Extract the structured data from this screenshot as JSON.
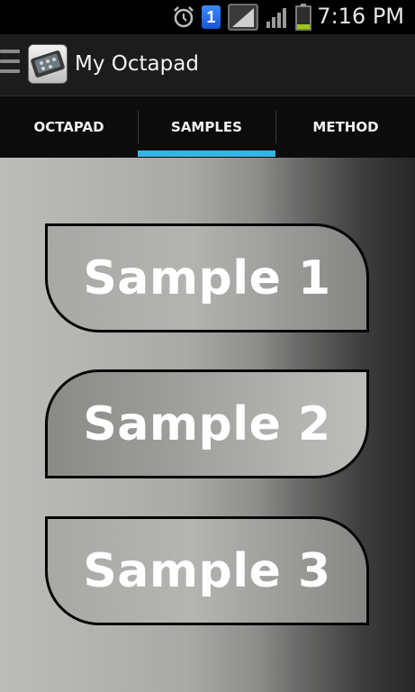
{
  "status_bar": {
    "time": "7:16 PM",
    "notification_badge": "1",
    "icons": [
      "alarm-icon",
      "notification-badge-icon",
      "wifi-signal-icon",
      "cell-signal-icon",
      "battery-icon"
    ]
  },
  "action_bar": {
    "title": "My Octapad",
    "icon": "app-octapad-icon",
    "menu_icon": "drawer-menu-icon"
  },
  "tabs": [
    {
      "label": "OCTAPAD",
      "selected": false
    },
    {
      "label": "SAMPLES",
      "selected": true
    },
    {
      "label": "METHOD",
      "selected": false
    }
  ],
  "colors": {
    "tab_indicator": "#33b5e5",
    "battery_level": "#99cc00"
  },
  "samples": [
    {
      "label": "Sample 1"
    },
    {
      "label": "Sample 2"
    },
    {
      "label": "Sample 3"
    }
  ]
}
